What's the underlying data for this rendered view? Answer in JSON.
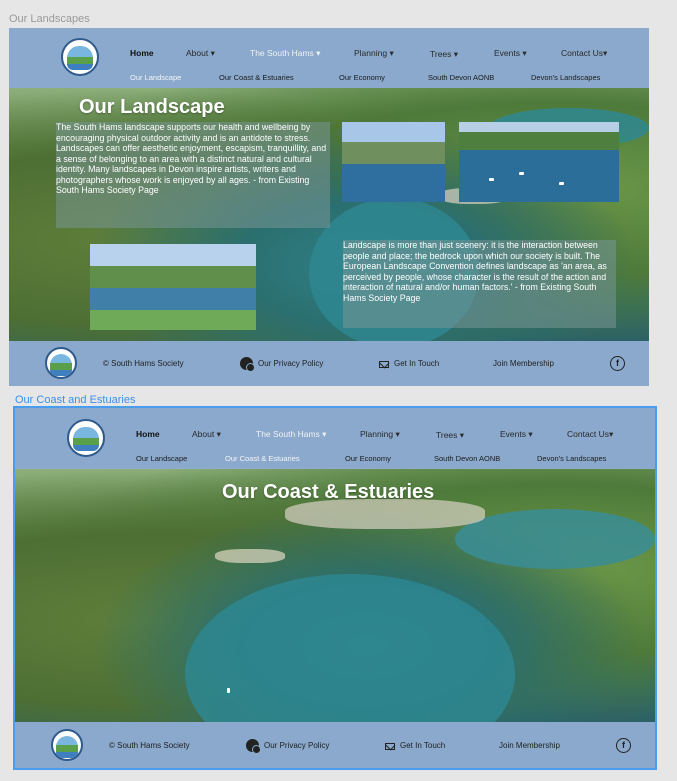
{
  "frames": [
    {
      "label": "Our Landscapes",
      "nav": {
        "items": [
          "Home",
          "About",
          "The South Hams",
          "Planning",
          "Trees",
          "Events",
          "Contact Us"
        ],
        "sub_items": [
          "Our Landscape",
          "Our Coast & Estuaries",
          "Our Economy",
          "South Devon AONB",
          "Devon's Landscapes"
        ]
      },
      "hero": {
        "title": "Our Landscape",
        "text_left": "The South Hams landscape supports our health and wellbeing by encouraging physical outdoor activity and is an antidote to stress. Landscapes can offer aesthetic enjoyment, escapism, tranquillity, and a sense of belonging to an area with a distinct natural and cultural identity. Many landscapes in Devon inspire artists, writers and photographers whose work is enjoyed by all ages. - from Existing South Hams Society Page",
        "text_right": "Landscape is more than just scenery: it is the interaction between people and place; the bedrock upon which our society is built. The European Landscape Convention defines landscape as 'an area, as perceived by people, whose character is the result of the action and interaction of natural and/or human factors.' - from Existing South Hams Society Page"
      },
      "footer": {
        "copyright": "© South Hams Society",
        "privacy": "Our Privacy Policy",
        "contact": "Get In Touch",
        "join": "Join Membership",
        "fb": "f"
      }
    },
    {
      "label": "Our Coast and Estuaries",
      "nav": {
        "items": [
          "Home",
          "About",
          "The South Hams",
          "Planning",
          "Trees",
          "Events",
          "Contact Us"
        ],
        "sub_items": [
          "Our Landscape",
          "Our Coast & Estuaries",
          "Our Economy",
          "South Devon AONB",
          "Devon's Landscapes"
        ]
      },
      "hero": {
        "title": "Our Coast & Estuaries"
      },
      "footer": {
        "copyright": "© South Hams Society",
        "privacy": "Our Privacy Policy",
        "contact": "Get In Touch",
        "join": "Join Membership",
        "fb": "f"
      }
    }
  ],
  "icons": [
    "logo",
    "chevron-down-icon",
    "privacy-icon",
    "mail-icon",
    "facebook-icon"
  ],
  "colors": {
    "header": "#8aa9cc",
    "selection": "#4a9cf0"
  }
}
